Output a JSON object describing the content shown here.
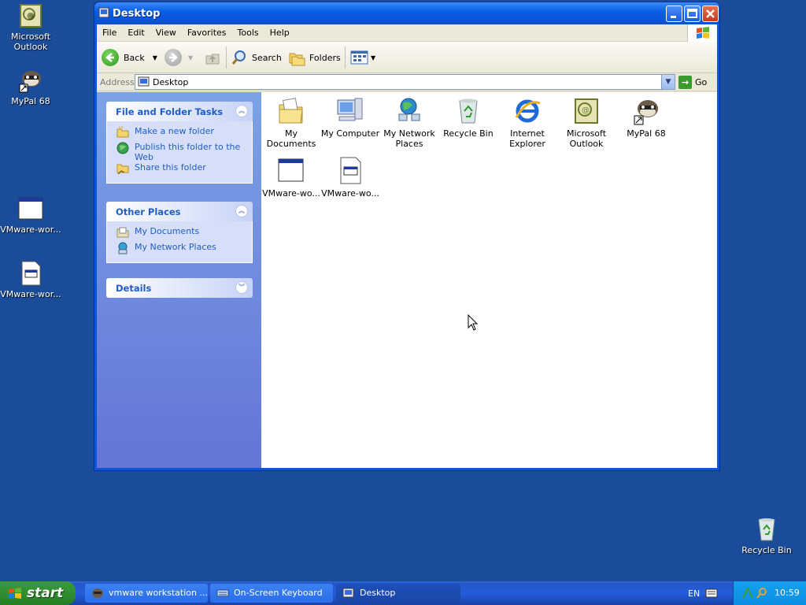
{
  "desktop": {
    "icons": [
      {
        "label": "Microsoft Outlook",
        "icon": "outlook-icon"
      },
      {
        "label": "MyPal 68",
        "icon": "mypal-icon"
      },
      {
        "label": "VMware-wor...",
        "icon": "window-app-icon"
      },
      {
        "label": "VMware-wor...",
        "icon": "document-icon"
      },
      {
        "label": "Recycle Bin",
        "icon": "recycle-bin-icon"
      }
    ]
  },
  "window": {
    "title": "Desktop",
    "menu": [
      "File",
      "Edit",
      "View",
      "Favorites",
      "Tools",
      "Help"
    ],
    "toolbar": {
      "back": "Back",
      "search": "Search",
      "folders": "Folders"
    },
    "address": {
      "label": "Address",
      "value": "Desktop",
      "go": "Go"
    },
    "tasks": {
      "file_folder": {
        "title": "File and Folder Tasks",
        "items": [
          "Make a new folder",
          "Publish this folder to the Web",
          "Share this folder"
        ]
      },
      "other_places": {
        "title": "Other Places",
        "items": [
          "My Documents",
          "My Network Places"
        ]
      },
      "details": {
        "title": "Details"
      }
    },
    "files": [
      {
        "label": "My Documents",
        "icon": "my-documents-icon"
      },
      {
        "label": "My Computer",
        "icon": "my-computer-icon"
      },
      {
        "label": "My Network Places",
        "icon": "network-places-icon"
      },
      {
        "label": "Recycle Bin",
        "icon": "recycle-bin-icon"
      },
      {
        "label": "Internet Explorer",
        "icon": "internet-explorer-icon"
      },
      {
        "label": "Microsoft Outlook",
        "icon": "outlook-icon"
      },
      {
        "label": "MyPal 68",
        "icon": "mypal-icon"
      },
      {
        "label": "VMware-wo...",
        "icon": "window-app-icon"
      },
      {
        "label": "VMware-wo...",
        "icon": "document-icon"
      }
    ]
  },
  "taskbar": {
    "start": "start",
    "tasks": [
      "vmware workstation ...",
      "On-Screen Keyboard",
      "Desktop"
    ],
    "lang": "EN",
    "clock": "10:59"
  },
  "colors": {
    "desktop_bg": "#1a4c99",
    "title_blue": "#0a5ee5",
    "task_link": "#215dc6",
    "start_green": "#2f8e2f"
  }
}
